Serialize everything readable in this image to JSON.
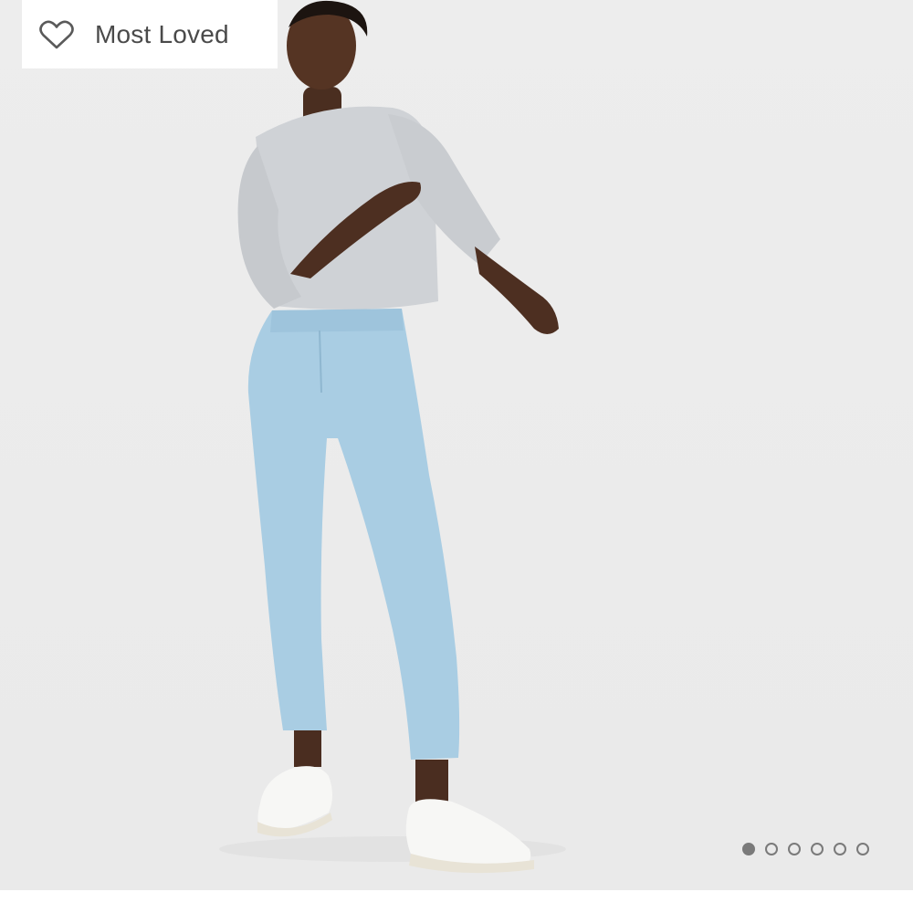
{
  "badge": {
    "label": "Most Loved",
    "icon": "heart-outline-icon"
  },
  "carousel": {
    "total_slides": 6,
    "active_index": 0
  },
  "colors": {
    "background": "#ececec",
    "badge_background": "#ffffff",
    "badge_text": "#4a4a4a",
    "dot": "#7a7a7a"
  }
}
